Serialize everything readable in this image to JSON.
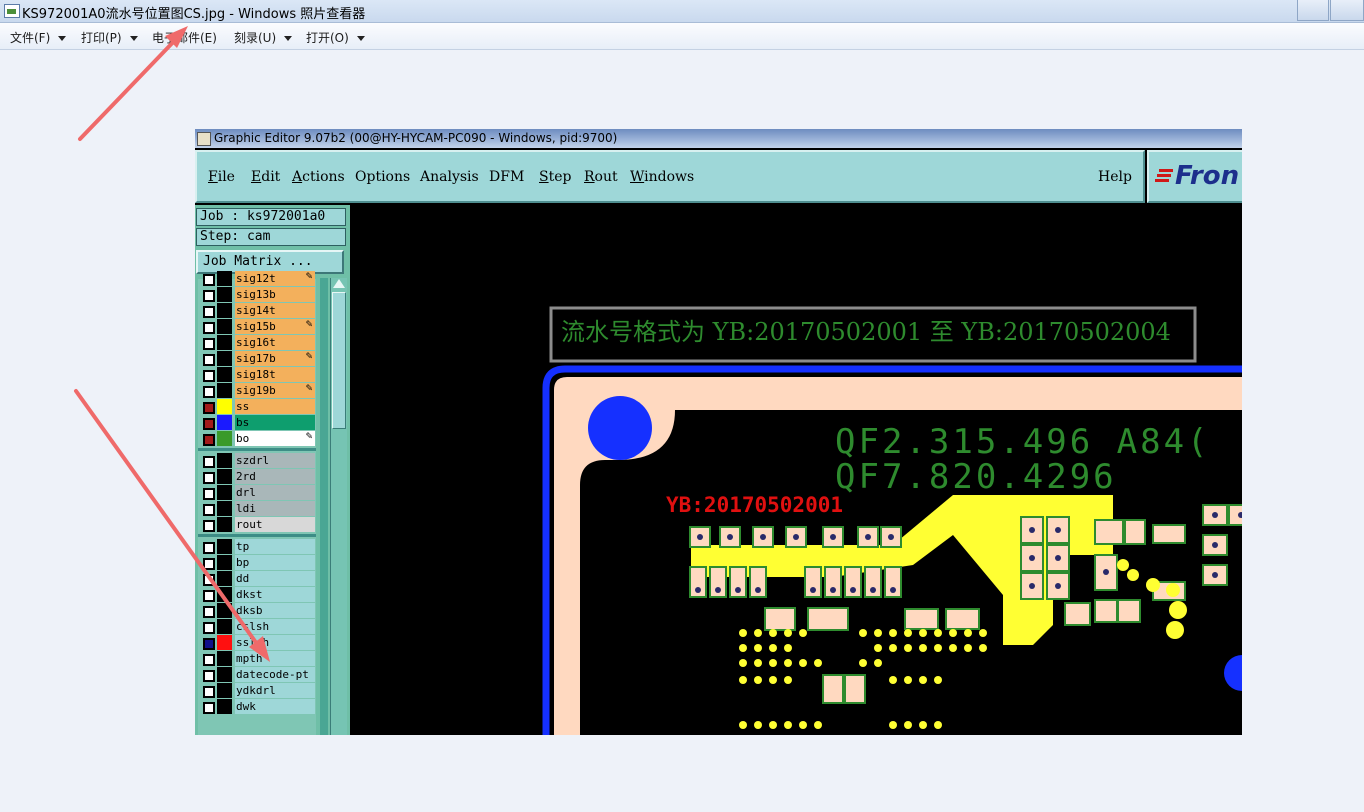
{
  "viewer": {
    "title": "KS972001A0流水号位置图CS.jpg - Windows 照片查看器",
    "menu": [
      {
        "label": "文件(F)"
      },
      {
        "label": "打印(P)"
      },
      {
        "label": "电子邮件(E)"
      },
      {
        "label": "刻录(U)"
      },
      {
        "label": "打开(O)"
      }
    ]
  },
  "editor": {
    "title": "Graphic Editor 9.07b2 (00@HY-HYCAM-PC090 - Windows, pid:9700)",
    "menu": [
      "File",
      "Edit",
      "Actions",
      "Options",
      "Analysis",
      "DFM",
      "Step",
      "Rout",
      "Windows"
    ],
    "help": "Help",
    "logo_text": "Fron",
    "job": "Job : ks972001a0",
    "step": "Step: cam",
    "job_matrix": "Job Matrix ...",
    "layers": [
      {
        "name": "sig12t",
        "color": "#f3b05c",
        "swatch": "#000000",
        "active": false,
        "mark": true
      },
      {
        "name": "sig13b",
        "color": "#f3b05c",
        "swatch": "#000000",
        "active": false,
        "mark": false
      },
      {
        "name": "sig14t",
        "color": "#f3b05c",
        "swatch": "#000000",
        "active": false,
        "mark": false
      },
      {
        "name": "sig15b",
        "color": "#f3b05c",
        "swatch": "#000000",
        "active": false,
        "mark": true
      },
      {
        "name": "sig16t",
        "color": "#f3b05c",
        "swatch": "#000000",
        "active": false,
        "mark": false
      },
      {
        "name": "sig17b",
        "color": "#f3b05c",
        "swatch": "#000000",
        "active": false,
        "mark": true
      },
      {
        "name": "sig18t",
        "color": "#f3b05c",
        "swatch": "#000000",
        "active": false,
        "mark": false
      },
      {
        "name": "sig19b",
        "color": "#f3b05c",
        "swatch": "#000000",
        "active": false,
        "mark": true
      },
      {
        "name": "ss",
        "color": "#f3b05c",
        "swatch": "#ffff00",
        "active": true,
        "mark": false
      },
      {
        "name": "bs",
        "color": "#0e9e6e",
        "swatch": "#1a1aff",
        "active": true,
        "mark": false
      },
      {
        "name": "bo",
        "color": "#ffffff",
        "swatch": "#3a9a2a",
        "active": true,
        "mark": true
      },
      {
        "name": "szdrl",
        "color": "#a9b7b9",
        "swatch": "#000000",
        "active": false,
        "mark": false
      },
      {
        "name": "2rd",
        "color": "#a9b7b9",
        "swatch": "#000000",
        "active": false,
        "mark": false
      },
      {
        "name": "drl",
        "color": "#a9b7b9",
        "swatch": "#000000",
        "active": false,
        "mark": false
      },
      {
        "name": "ldi",
        "color": "#a9b7b9",
        "swatch": "#000000",
        "active": false,
        "mark": false
      },
      {
        "name": "rout",
        "color": "#d8d8d8",
        "swatch": "#000000",
        "active": false,
        "mark": false
      },
      {
        "name": "tp",
        "color": "#9ed7d8",
        "swatch": "#000000",
        "active": false,
        "mark": false
      },
      {
        "name": "bp",
        "color": "#9ed7d8",
        "swatch": "#000000",
        "active": false,
        "mark": false
      },
      {
        "name": "dd",
        "color": "#9ed7d8",
        "swatch": "#000000",
        "active": false,
        "mark": false
      },
      {
        "name": "dkst",
        "color": "#9ed7d8",
        "swatch": "#000000",
        "active": false,
        "mark": false
      },
      {
        "name": "dksb",
        "color": "#9ed7d8",
        "swatch": "#000000",
        "active": false,
        "mark": false
      },
      {
        "name": "cslsh",
        "color": "#9ed7d8",
        "swatch": "#000000",
        "active": false,
        "mark": false
      },
      {
        "name": "sslsh",
        "color": "#9ed7d8",
        "swatch": "#ff1010",
        "active": true,
        "mark": false
      },
      {
        "name": "mpth",
        "color": "#9ed7d8",
        "swatch": "#000000",
        "active": false,
        "mark": false
      },
      {
        "name": "datecode-pt",
        "color": "#9ed7d8",
        "swatch": "#000000",
        "active": false,
        "mark": false
      },
      {
        "name": "ydkdrl",
        "color": "#9ed7d8",
        "swatch": "#000000",
        "active": false,
        "mark": false
      },
      {
        "name": "dwk",
        "color": "#9ed7d8",
        "swatch": "#000000",
        "active": false,
        "mark": false
      }
    ],
    "canvas": {
      "note": "流水号格式为 YB:20170502001 至 YB:20170502004",
      "part_line1": "QF2.315.496 A84(",
      "part_line2": "QF7.820.4296",
      "serial": "YB:20170502001",
      "colors": {
        "silk_green": "#2e8b2e",
        "pad_yellow": "#ffff33",
        "serial_red": "#e01010",
        "board_peach": "#ffd9c0",
        "border_blue": "#1530ff"
      }
    }
  }
}
